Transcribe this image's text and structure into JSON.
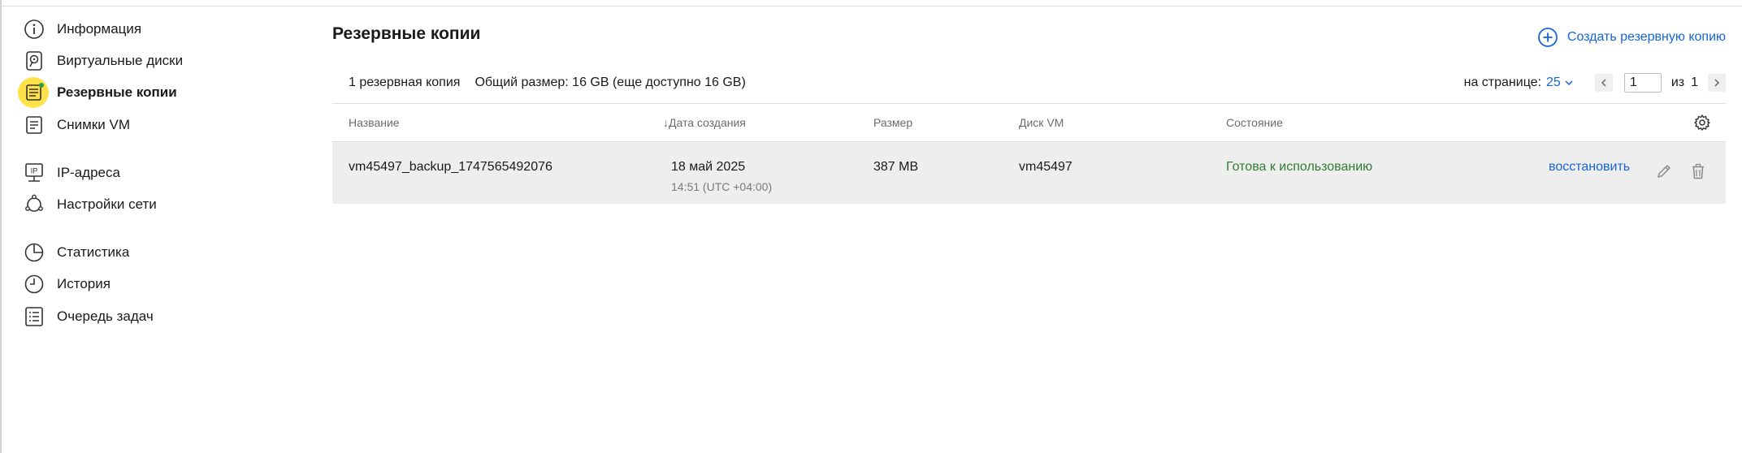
{
  "sidebar": {
    "items": [
      {
        "label": "Информация",
        "icon": "info-icon"
      },
      {
        "label": "Виртуальные диски",
        "icon": "disk-icon"
      },
      {
        "label": "Резервные копии",
        "icon": "backup-icon",
        "active": true
      },
      {
        "label": "Снимки VM",
        "icon": "snapshot-icon"
      },
      {
        "label": "IP-адреса",
        "icon": "ip-address-icon"
      },
      {
        "label": "Настройки сети",
        "icon": "network-settings-icon"
      },
      {
        "label": "Статистика",
        "icon": "pie-chart-icon"
      },
      {
        "label": "История",
        "icon": "clock-icon"
      },
      {
        "label": "Очередь задач",
        "icon": "task-list-icon"
      }
    ]
  },
  "header": {
    "title": "Резервные копии",
    "create_label": "Создать резервную копию"
  },
  "summary": {
    "count": "1 резервная копия",
    "size": "Общий размер: 16 GB (еще доступно 16 GB)"
  },
  "pager": {
    "per_page_label": "на странице:",
    "per_page_value": "25",
    "current_page": "1",
    "of_label": "из",
    "total_pages": "1"
  },
  "table": {
    "columns": {
      "name": "Название",
      "created": "↓Дата создания",
      "size": "Размер",
      "disk": "Диск VM",
      "state": "Состояние"
    },
    "rows": [
      {
        "name": "vm45497_backup_1747565492076",
        "date": "18 май 2025",
        "time": "14:51 (UTC +04:00)",
        "size": "387 MB",
        "disk": "vm45497",
        "state": "Готова к использованию",
        "restore_label": "восстановить"
      }
    ]
  },
  "colors": {
    "accent": "#1565d8",
    "status_ready": "#2e7d32",
    "active_highlight": "#ffe14a",
    "row_background": "#eeeeee"
  }
}
